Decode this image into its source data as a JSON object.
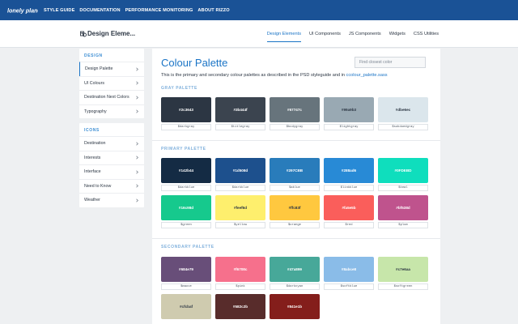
{
  "topbar": {
    "logo_text": "lonely planet",
    "nav": [
      "STYLE GUIDE",
      "DOCUMENTATION",
      "PERFORMANCE MONITORING",
      "ABOUT RIZZO"
    ]
  },
  "subheader": {
    "title": "Design Eleme...",
    "tabs": [
      "Design Elements",
      "UI Components",
      "JS Components",
      "Widgets",
      "CSS Utilities"
    ],
    "active_tab": "Design Elements"
  },
  "sidebar": {
    "groups": [
      {
        "heading": "DESIGN",
        "items": [
          "Design Palette",
          "UI Colours",
          "Destination Next Colors",
          "Typography"
        ]
      },
      {
        "heading": "ICONS",
        "items": [
          "Destination",
          "Interests",
          "Interface",
          "Need to Know",
          "Weather"
        ]
      }
    ],
    "active_item": "Design Palette"
  },
  "main": {
    "title": "Colour Palette",
    "search_placeholder": "Find closest color",
    "intro_text": "This is the primary and secondary colour palettes as described in the PSD styleguide and in ",
    "intro_link": "ccolour_palette.sass"
  },
  "palettes": {
    "gray": {
      "label": "GRAY PALETTE",
      "swatches": [
        {
          "hex": "#2c3643",
          "name": "$darkgray",
          "text": "#ffffff"
        },
        {
          "hex": "#3b444f",
          "name": "$titlegray",
          "text": "#ffffff"
        },
        {
          "hex": "#67747c",
          "name": "$bodygray",
          "text": "#ffffff"
        },
        {
          "hex": "#99a9b3",
          "name": "$lightgray",
          "text": "#2c3643"
        },
        {
          "hex": "#dbe6ec",
          "name": "$subduedgray",
          "text": "#2c3643"
        }
      ]
    },
    "primary": {
      "label": "PRIMARY PALETTE",
      "swatches": [
        {
          "hex": "#142b44",
          "name": "$darkblue",
          "text": "#ffffff"
        },
        {
          "hex": "#1d508d",
          "name": "$darkblue",
          "text": "#ffffff"
        },
        {
          "hex": "#297CBB",
          "name": "$ablue",
          "text": "#ffffff"
        },
        {
          "hex": "#288ad6",
          "name": "$linkblue",
          "text": "#ffffff"
        },
        {
          "hex": "#0FDEBD",
          "name": "$teal",
          "text": "#ffffff"
        },
        {
          "hex": "#16c98d",
          "name": "$green",
          "text": "#ffffff"
        },
        {
          "hex": "#feef6d",
          "name": "$yellow",
          "text": "#2c3643"
        },
        {
          "hex": "#ffc83f",
          "name": "$orange",
          "text": "#2c3643"
        },
        {
          "hex": "#fa5e5b",
          "name": "$red",
          "text": "#ffffff"
        },
        {
          "hex": "#bf538d",
          "name": "$plum",
          "text": "#ffffff"
        }
      ]
    },
    "secondary": {
      "label": "SECONDARY PALETTE",
      "swatches": [
        {
          "hex": "#684e79",
          "name": "$mauve",
          "text": "#ffffff"
        },
        {
          "hex": "#f6708c",
          "name": "$pink",
          "text": "#ffffff"
        },
        {
          "hex": "#47a899",
          "name": "$darkcyan",
          "text": "#ffffff"
        },
        {
          "hex": "#8abce8",
          "name": "$softblue",
          "text": "#ffffff"
        },
        {
          "hex": "#c7e6aa",
          "name": "$softgreen",
          "text": "#2c3643"
        },
        {
          "hex": "#cfcbaf",
          "name": "",
          "text": "#2c3643"
        },
        {
          "hex": "#582c2b",
          "name": "",
          "text": "#ffffff"
        },
        {
          "hex": "#841e1b",
          "name": "",
          "text": "#ffffff"
        }
      ]
    }
  },
  "colors": {
    "brand_blue": "#1a5296",
    "accent": "#1a74c6"
  }
}
